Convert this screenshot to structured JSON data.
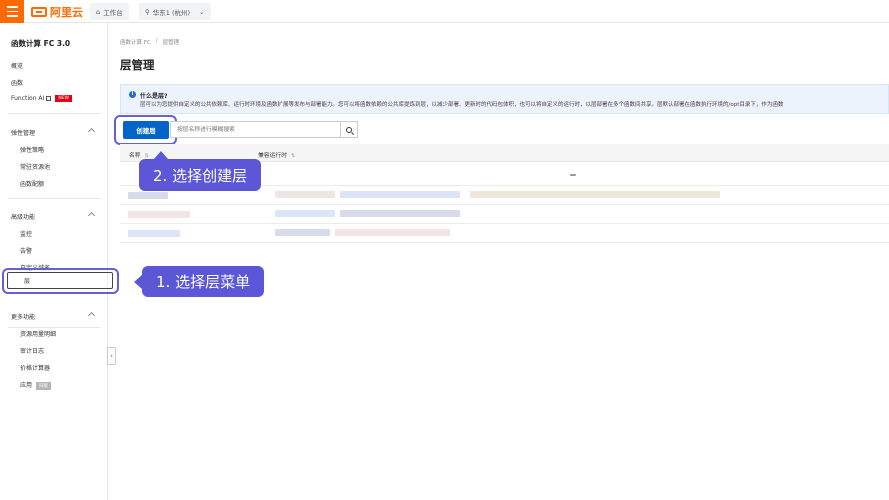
{
  "topbar": {
    "brand": "阿里云",
    "workbench": "工作台",
    "region": "华东1 (杭州)"
  },
  "sidebar": {
    "title": "函数计算 FC 3.0",
    "items": [
      {
        "label": "概览"
      },
      {
        "label": "函数"
      },
      {
        "label": "Function AI",
        "badge": "NEW"
      }
    ],
    "groups": [
      {
        "label": "弹性管理",
        "items": [
          "弹性策略",
          "常驻资源池",
          "函数配额"
        ]
      },
      {
        "label": "高级功能",
        "items": [
          "监控",
          "告警",
          "自定义域名",
          "层"
        ]
      },
      {
        "label": "更多功能",
        "items": [
          "资源用量明细",
          "审计日志",
          "价格计算器",
          "应用"
        ],
        "badge": "旧版"
      }
    ]
  },
  "breadcrumb": [
    "函数计算 FC",
    "/",
    "层管理"
  ],
  "page_title": "层管理",
  "info": {
    "title": "什么是层?",
    "text": "层可以为您提供自定义的公共依赖库、运行时环境及函数扩展等发布与部署能力。您可以将函数依赖的公共库提炼到层，以减少部署、更新时的代码包体积，也可以将自定义的运行时，以层部署在多个函数间共享。层默认部署在函数执行环境的/opt目录下，作为函数"
  },
  "toolbar": {
    "create_label": "创建层",
    "search_placeholder": "按层名称进行模糊搜索"
  },
  "table": {
    "columns": [
      "名称",
      "兼容运行时"
    ]
  },
  "callouts": {
    "step1": "1. 选择层菜单",
    "step2": "2. 选择创建层"
  },
  "colors": {
    "brand": "#ff6a00",
    "primary": "#0064c8",
    "callout": "#5b57d6"
  }
}
